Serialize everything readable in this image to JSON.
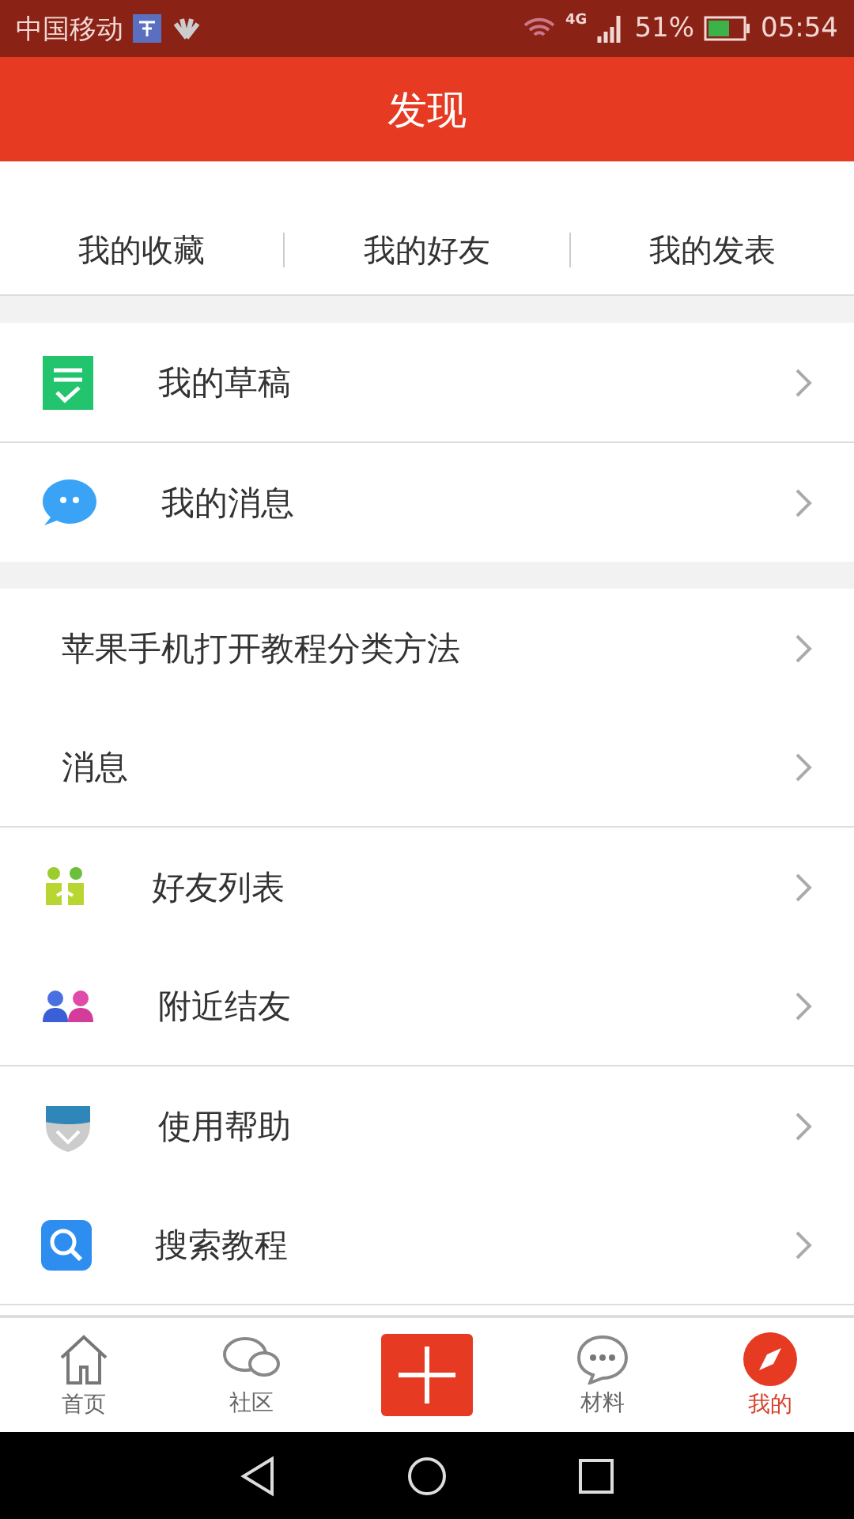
{
  "status_bar": {
    "carrier": "中国移动",
    "network": "4G",
    "battery": "51%",
    "time": "05:54"
  },
  "header": {
    "title": "发现"
  },
  "quick_tabs": [
    {
      "label": "我的收藏"
    },
    {
      "label": "我的好友"
    },
    {
      "label": "我的发表"
    }
  ],
  "sections": [
    {
      "groups": [
        [
          {
            "kind": "icon",
            "label": "我的草稿"
          }
        ],
        [
          {
            "kind": "icon",
            "label": "我的消息"
          }
        ]
      ]
    },
    {
      "groups": [
        [
          {
            "kind": "plain",
            "label": "苹果手机打开教程分类方法"
          },
          {
            "kind": "plain",
            "label": "消息"
          }
        ],
        [
          {
            "kind": "icon",
            "label": "好友列表"
          },
          {
            "kind": "icon",
            "label": "附近结友"
          }
        ],
        [
          {
            "kind": "icon",
            "label": "使用帮助"
          },
          {
            "kind": "icon",
            "label": "搜索教程"
          }
        ]
      ]
    }
  ],
  "bottom_nav": [
    {
      "kind": "tab",
      "label": "首页",
      "selected": false
    },
    {
      "kind": "tab",
      "label": "社区",
      "selected": false
    },
    {
      "kind": "add"
    },
    {
      "kind": "tab",
      "label": "材料",
      "selected": false
    },
    {
      "kind": "tab",
      "label": "我的",
      "selected": true
    }
  ]
}
